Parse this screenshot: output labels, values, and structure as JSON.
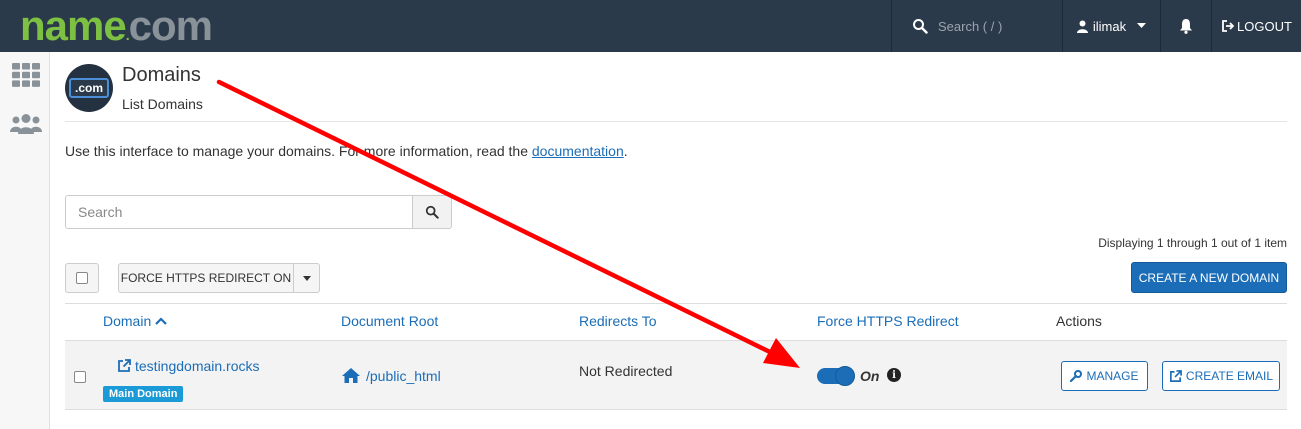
{
  "header": {
    "logo_name": "name",
    "logo_dot": ".",
    "logo_com": "com",
    "search_placeholder": "Search ( / )",
    "user_name": "ilimak",
    "logout_label": "LOGOUT"
  },
  "page": {
    "icon_text": ".com",
    "title": "Domains",
    "subtitle": "List Domains",
    "intro_text": "Use this interface to manage your domains. For more information, read the",
    "intro_link": "documentation",
    "intro_end": "."
  },
  "search": {
    "placeholder": "Search"
  },
  "toolbar": {
    "displaying": "Displaying 1 through 1 out of 1 item",
    "bulk_action": "FORCE HTTPS REDIRECT ON",
    "create_button": "CREATE A NEW DOMAIN"
  },
  "table": {
    "headers": {
      "domain": "Domain",
      "document_root": "Document Root",
      "redirects_to": "Redirects To",
      "force_https": "Force HTTPS Redirect",
      "actions": "Actions"
    },
    "rows": [
      {
        "domain": "testingdomain.rocks",
        "badge": "Main Domain",
        "document_root": "/public_html",
        "redirects_to": "Not Redirected",
        "force_https_state": "On",
        "force_https_enabled": true,
        "manage_label": "MANAGE",
        "create_email_label": "CREATE EMAIL"
      }
    ]
  },
  "colors": {
    "topbar": "#2b3a4a",
    "accent": "#1b6db7",
    "logo_green": "#7dc142",
    "annotation_arrow": "#ff0000"
  }
}
